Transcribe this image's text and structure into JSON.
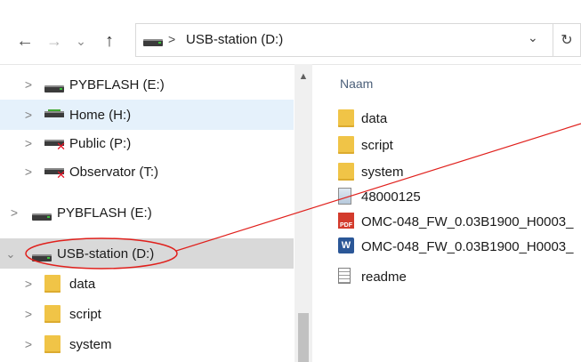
{
  "address": {
    "path_label": "USB-station (D:)",
    "separator": ">",
    "dropdown_glyph": "⌄",
    "refresh_glyph": "↻"
  },
  "nav_buttons": {
    "back": "←",
    "forward": "→",
    "recent": "⌄",
    "up": "↑"
  },
  "tree": [
    {
      "label": "PYBFLASH (E:)",
      "icon": "drive-icon",
      "expanded": false,
      "state": "normal"
    },
    {
      "label": "Home (H:)",
      "icon": "network-drive-icon",
      "expanded": false,
      "state": "hover"
    },
    {
      "label": "Public (P:)",
      "icon": "network-drive-disconnected-icon",
      "expanded": false,
      "state": "normal"
    },
    {
      "label": "Observator (T:)",
      "icon": "network-drive-disconnected-icon",
      "expanded": false,
      "state": "normal"
    },
    {
      "label": "PYBFLASH (E:)",
      "icon": "drive-icon",
      "expanded": false,
      "state": "normal"
    },
    {
      "label": "USB-station (D:)",
      "icon": "drive-icon",
      "expanded": true,
      "state": "selected"
    },
    {
      "label": "data",
      "icon": "folder-icon",
      "expanded": false,
      "state": "normal"
    },
    {
      "label": "script",
      "icon": "folder-icon",
      "expanded": false,
      "state": "normal"
    },
    {
      "label": "system",
      "icon": "folder-icon",
      "expanded": false,
      "state": "normal"
    }
  ],
  "content": {
    "column_header": "Naam",
    "files": [
      {
        "name": "data",
        "icon": "folder-icon"
      },
      {
        "name": "script",
        "icon": "folder-icon"
      },
      {
        "name": "system",
        "icon": "folder-icon"
      },
      {
        "name": "48000125",
        "icon": "document-icon"
      },
      {
        "name": "OMC-048_FW_0.03B1900_H0003_",
        "icon": "pdf-icon"
      },
      {
        "name": "OMC-048_FW_0.03B1900_H0003_",
        "icon": "word-icon"
      },
      {
        "name": "readme",
        "icon": "text-file-icon"
      }
    ]
  },
  "colors": {
    "hover_row": "#e5f1fb",
    "selected_row": "#d9d9d9",
    "annotation_red": "#e0201c",
    "folder_yellow": "#f0c447"
  }
}
